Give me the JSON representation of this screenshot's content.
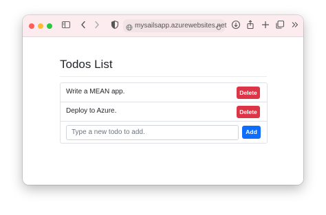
{
  "browser": {
    "url": "mysailsapp.azurewebsites.net",
    "colors": {
      "toolbar": "#fcecef",
      "close": "#ff5f57",
      "minimize": "#febc2e",
      "zoom": "#28c840"
    },
    "icons": [
      "sidebar-icon",
      "back-icon",
      "forward-icon",
      "shield-icon",
      "globe-icon",
      "reload-icon",
      "download-icon",
      "share-icon",
      "new-tab-icon",
      "tabs-overview-icon",
      "more-icon"
    ]
  },
  "page": {
    "title": "Todos List",
    "todos": [
      {
        "text": "Write a MEAN app.",
        "delete_label": "Delete"
      },
      {
        "text": "Deploy to Azure.",
        "delete_label": "Delete"
      }
    ],
    "input": {
      "placeholder": "Type a new todo to add.",
      "value": ""
    },
    "add_label": "Add",
    "colors": {
      "delete": "#dc3545",
      "add": "#0d6efd"
    }
  }
}
